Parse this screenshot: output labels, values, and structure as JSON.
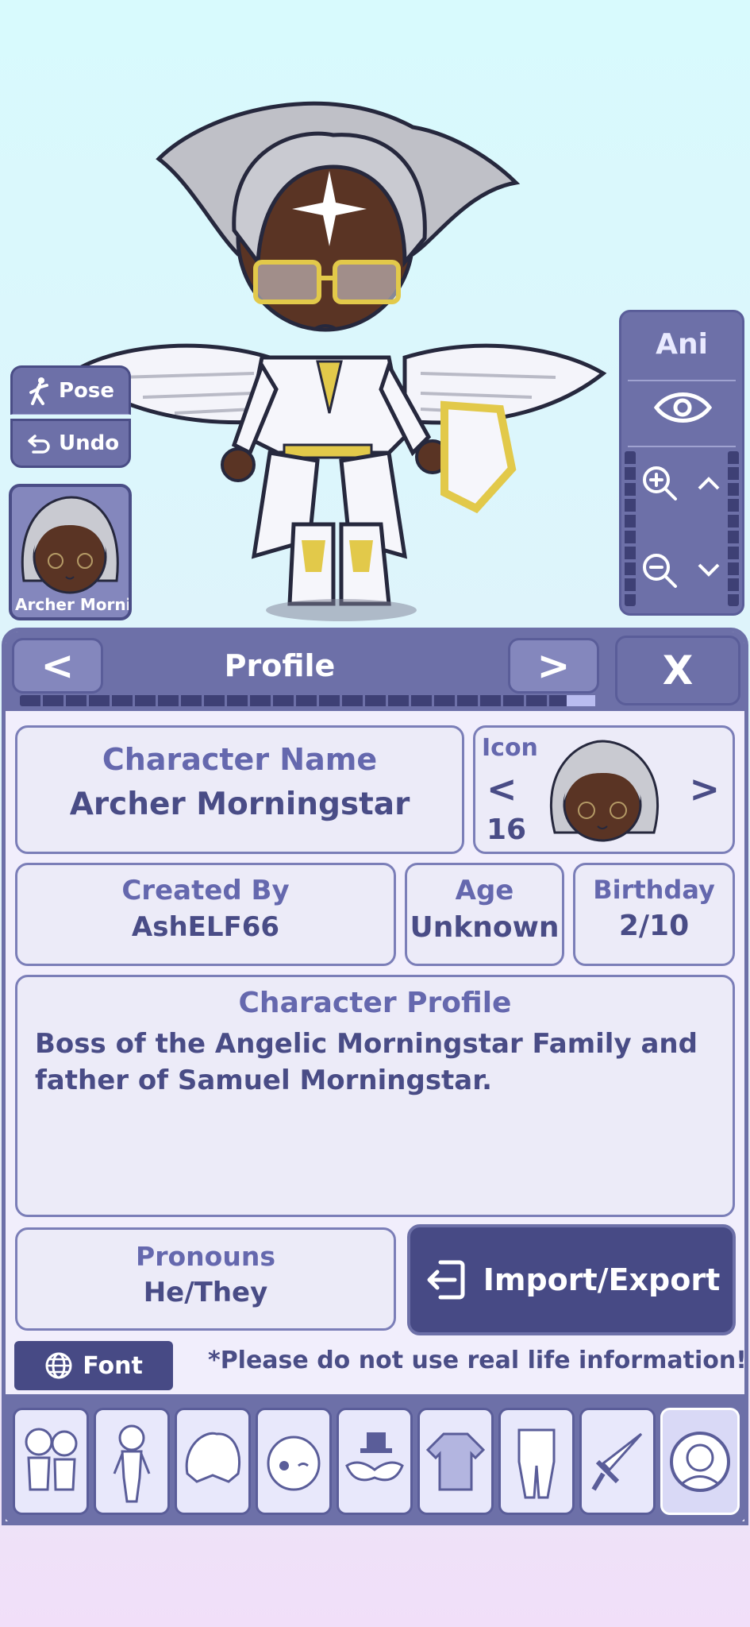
{
  "side": {
    "pose_label": "Pose",
    "undo_label": "Undo",
    "portrait_name": "Archer Mornir"
  },
  "right_panel": {
    "ani_label": "Ani"
  },
  "header": {
    "title": "Profile",
    "prev": "<",
    "next": ">",
    "close": "X"
  },
  "progress": {
    "fraction": 0.95
  },
  "profile": {
    "name_label": "Character Name",
    "name_value": "Archer Morningstar",
    "icon_label": "Icon",
    "icon_number": "16",
    "icon_prev": "<",
    "icon_next": ">",
    "created_label": "Created By",
    "created_value": "AshELF66",
    "age_label": "Age",
    "age_value": "Unknown",
    "birthday_label": "Birthday",
    "birthday_value": "2/10",
    "profile_label": "Character Profile",
    "profile_text": "Boss of the Angelic Morningstar Family and father of Samuel Morningstar.",
    "pronouns_label": "Pronouns",
    "pronouns_value": "He/They",
    "import_label": "Import/Export",
    "font_label": "Font",
    "warning": "*Please do not use real life information!"
  },
  "tabs": [
    "characters-tab",
    "body-tab",
    "hair-tab",
    "face-tab",
    "accessories-tab",
    "clothes-tab",
    "pants-tab",
    "props-tab",
    "profile-tab"
  ],
  "colors": {
    "panel": "#6d70a8",
    "dark": "#474a85",
    "accent": "#6568ae",
    "text": "#494c86"
  }
}
